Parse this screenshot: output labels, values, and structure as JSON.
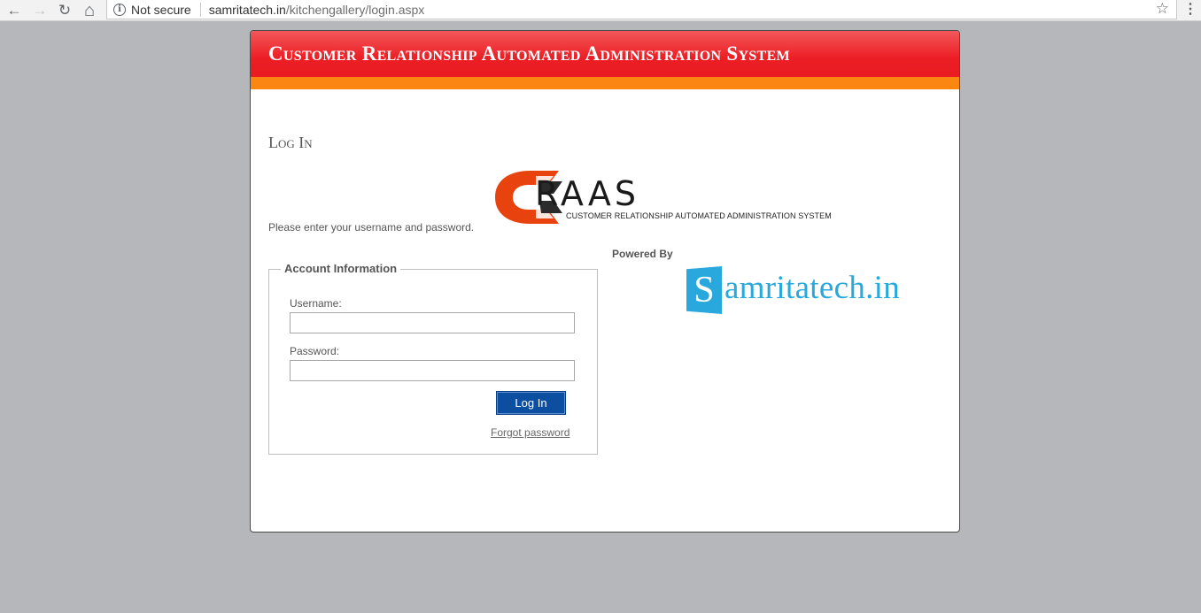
{
  "browser": {
    "back_icon": "←",
    "forward_icon": "→",
    "reload_icon": "↻",
    "home_icon": "⌂",
    "security_label": "Not secure",
    "url_host": "samritatech.in",
    "url_path": "/kitchengallery/login.aspx",
    "bookmark_icon": "☆",
    "menu_icon": "⋮"
  },
  "header": {
    "title": "Customer Relationship Automated Administration System",
    "accent_color": "#ec1e25",
    "bar_color": "#fb8712"
  },
  "page": {
    "section_title": "Log In",
    "instructions": "Please enter your username and password."
  },
  "logo": {
    "word": "RAAS",
    "tagline": "CUSTOMER RELATIONSHIP AUTOMATED ADMINISTRATION SYSTEM"
  },
  "powered": {
    "label": "Powered By",
    "brand_initial": "S",
    "brand_rest": "amritatech.in",
    "brand_color": "#29a8dd"
  },
  "account": {
    "legend": "Account Information",
    "username_label": "Username:",
    "username_value": "",
    "password_label": "Password:",
    "password_value": "",
    "login_label": "Log In",
    "forgot_label": "Forgot password"
  }
}
